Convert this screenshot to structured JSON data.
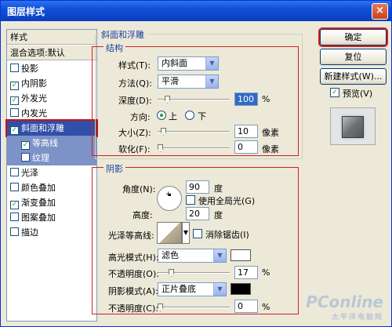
{
  "window": {
    "title": "图层样式",
    "close_glyph": "×"
  },
  "style_list": {
    "header": "样式",
    "blend_header": "混合选项:默认",
    "items": [
      {
        "label": "投影",
        "checked": false
      },
      {
        "label": "内阴影",
        "checked": true
      },
      {
        "label": "外发光",
        "checked": true
      },
      {
        "label": "内发光",
        "checked": false
      },
      {
        "label": "斜面和浮雕",
        "checked": true,
        "selected": true
      },
      {
        "label": "等高线",
        "checked": true,
        "sub": true
      },
      {
        "label": "纹理",
        "checked": false,
        "sub": true
      },
      {
        "label": "光泽",
        "checked": false
      },
      {
        "label": "颜色叠加",
        "checked": false
      },
      {
        "label": "渐变叠加",
        "checked": true
      },
      {
        "label": "图案叠加",
        "checked": false
      },
      {
        "label": "描边",
        "checked": false
      }
    ]
  },
  "bevel": {
    "group_title": "斜面和浮雕",
    "structure_title": "结构",
    "style_label": "样式(T):",
    "style_value": "内斜面",
    "technique_label": "方法(Q):",
    "technique_value": "平滑",
    "depth_label": "深度(D):",
    "depth_value": "100",
    "depth_unit": "%",
    "depth_fraction": 0.1,
    "direction_label": "方向:",
    "direction_up": "上",
    "direction_down": "下",
    "direction_selected": "上",
    "size_label": "大小(Z):",
    "size_value": "10",
    "size_unit": "像素",
    "size_fraction": 0.05,
    "soften_label": "软化(F):",
    "soften_value": "0",
    "soften_unit": "像素",
    "soften_fraction": 0.0
  },
  "shading": {
    "title": "阴影",
    "angle_label": "角度(N):",
    "angle_value": "90",
    "angle_unit": "度",
    "global_light_label": "使用全局光(G)",
    "global_light_checked": false,
    "altitude_label": "高度:",
    "altitude_value": "20",
    "altitude_unit": "度",
    "gloss_label": "光泽等高线:",
    "antialias_label": "消除锯齿(I)",
    "antialias_checked": false,
    "highlight_mode_label": "高光模式(H):",
    "highlight_mode_value": "滤色",
    "highlight_color": "#ffffff",
    "highlight_opacity_label": "不透明度(O):",
    "highlight_opacity_value": "17",
    "highlight_opacity_unit": "%",
    "highlight_opacity_fraction": 0.17,
    "shadow_mode_label": "阴影模式(A):",
    "shadow_mode_value": "正片叠底",
    "shadow_color": "#000000",
    "shadow_opacity_label": "不透明度(C):",
    "shadow_opacity_value": "0",
    "shadow_opacity_unit": "%",
    "shadow_opacity_fraction": 0.0
  },
  "buttons": {
    "ok": "确定",
    "reset": "复位",
    "new_style": "新建样式(W)...",
    "preview_label": "预览(V)",
    "preview_checked": true
  },
  "watermark": {
    "brand": "PConline",
    "sub": "太平洋电脑网"
  },
  "colors": {
    "accent_red": "#d02020",
    "legend_blue": "#1f3fa0",
    "selected_bg": "#2f4fa9"
  }
}
